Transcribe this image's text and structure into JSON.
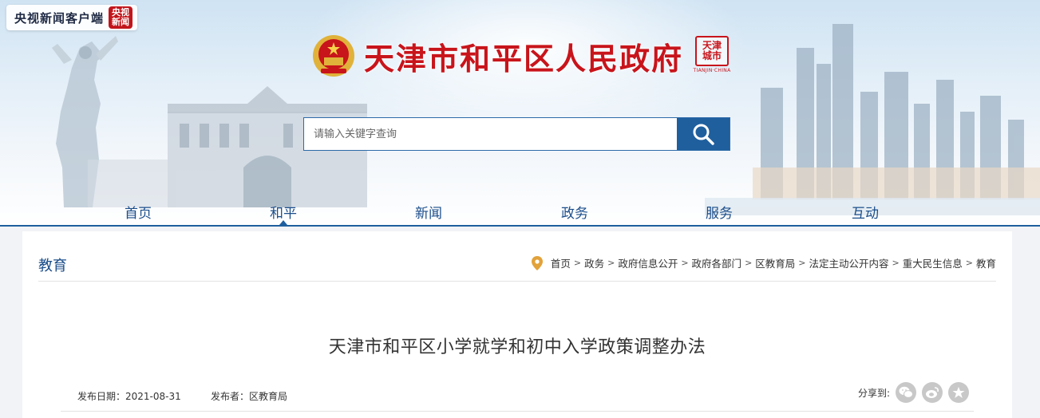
{
  "watermark": {
    "brand": "央视新闻客户端",
    "badge": "央视新闻"
  },
  "site": {
    "title": "天津市和平区人民政府",
    "seal_text": "天津 城市",
    "seal_caption": "TIANJIN·CHINA"
  },
  "search": {
    "placeholder": "请输入关键字查询",
    "icon": "search-icon"
  },
  "nav": {
    "items": [
      {
        "label": "首页"
      },
      {
        "label": "和平"
      },
      {
        "label": "新闻"
      },
      {
        "label": "政务"
      },
      {
        "label": "服务"
      },
      {
        "label": "互动"
      }
    ],
    "active_index": 1
  },
  "section": {
    "title": "教育"
  },
  "breadcrumb": {
    "icon": "location-pin-icon",
    "items": [
      "首页",
      "政务",
      "政府信息公开",
      "政府各部门",
      "区教育局",
      "法定主动公开内容",
      "重大民生信息",
      "教育"
    ],
    "separator": ">"
  },
  "article": {
    "title": "天津市和平区小学就学和初中入学政策调整办法",
    "date_label": "发布日期：",
    "date": "2021-08-31",
    "publisher_label": "发布者：",
    "publisher": "区教育局",
    "share_label": "分享到:",
    "share_icons": [
      "wechat-icon",
      "weibo-icon",
      "favorite-star-icon"
    ]
  },
  "colors": {
    "brand_red": "#c8141b",
    "nav_blue": "#1a4d8a",
    "search_blue": "#1f5f9e",
    "page_bg": "#f1f3f6"
  }
}
